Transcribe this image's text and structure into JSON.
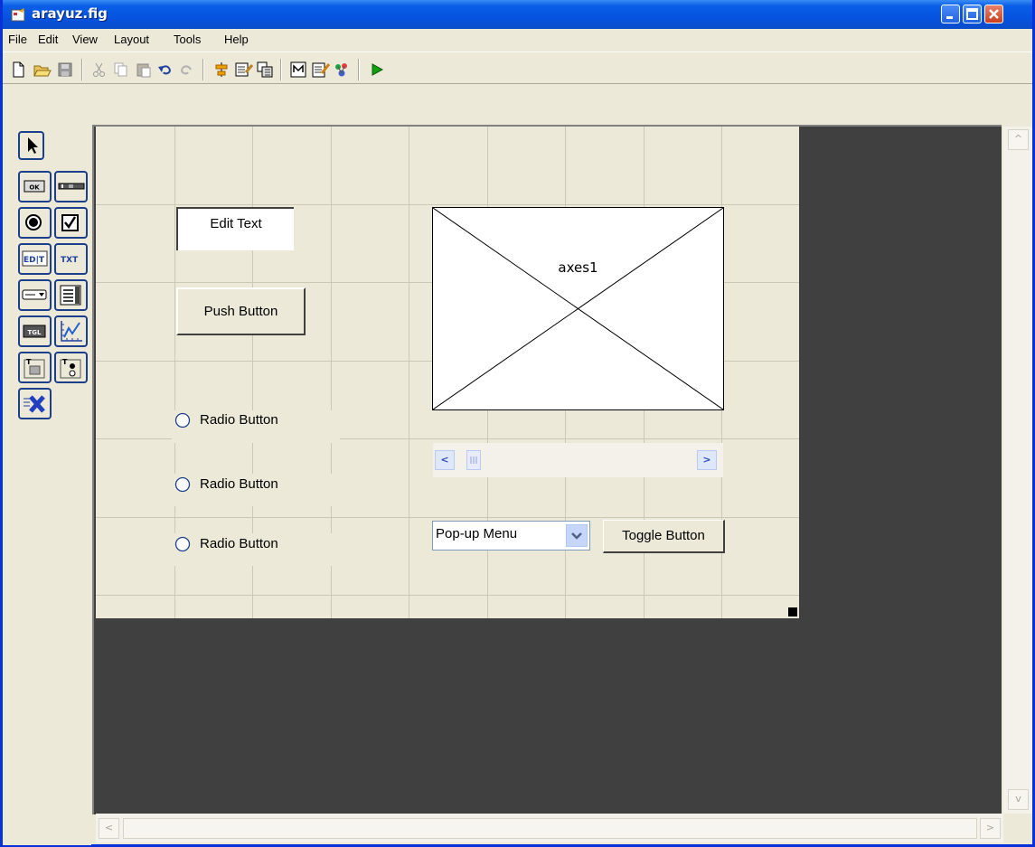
{
  "window": {
    "title": "arayuz.fig"
  },
  "menubar": {
    "items": [
      "File",
      "Edit",
      "View",
      "Layout",
      "Tools",
      "Help"
    ]
  },
  "toolbar": {
    "icons": [
      "new-file-icon",
      "open-folder-icon",
      "save-icon",
      "cut-icon",
      "copy-icon",
      "paste-icon",
      "undo-icon",
      "redo-icon",
      "align-objects-icon",
      "menu-editor-icon",
      "tab-order-editor-icon",
      "m-file-editor-icon",
      "property-inspector-icon",
      "object-browser-icon",
      "run-icon"
    ]
  },
  "palette": {
    "tools": [
      "select-icon",
      "push-button-tool-icon",
      "slider-tool-icon",
      "radio-button-tool-icon",
      "checkbox-tool-icon",
      "edit-text-tool-icon",
      "static-text-tool-icon",
      "popup-menu-tool-icon",
      "listbox-tool-icon",
      "toggle-button-tool-icon",
      "axes-tool-icon",
      "panel-tool-icon",
      "button-group-tool-icon",
      "activex-tool-icon"
    ]
  },
  "canvas": {
    "edit_text": "Edit Text",
    "push_button": "Push Button",
    "radio_buttons": [
      "Radio Button",
      "Radio Button",
      "Radio Button"
    ],
    "axes_label": "axes1",
    "popup_menu": "Pop-up Menu",
    "toggle_button": "Toggle Button"
  },
  "colors": {
    "titlebar": "#0553e0",
    "canvas": "#ece9d8",
    "editor_background": "#404040",
    "run_icon": "#10a010"
  }
}
